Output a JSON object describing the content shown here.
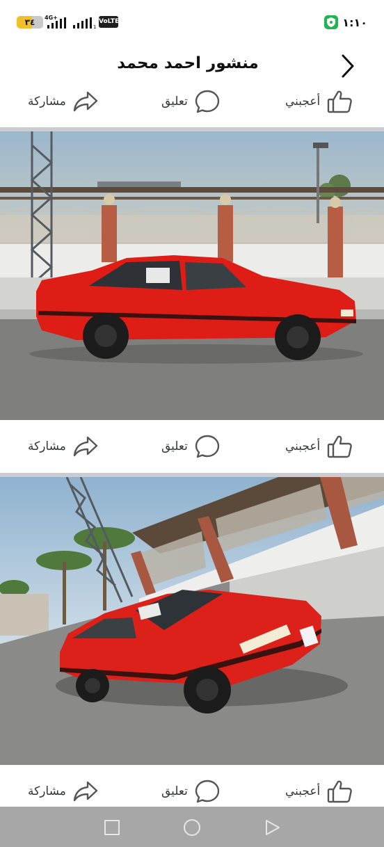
{
  "status_bar": {
    "battery": "٣٤",
    "network": "4G+",
    "volte": "VoLTE",
    "time": "١:١٠",
    "colors": {
      "battery": "#f0c02a",
      "shield": "#20b452"
    }
  },
  "header": {
    "title": "منشور احمد محمد",
    "back_icon": "chevron-right-icon"
  },
  "actions": {
    "like": "أعجبني",
    "comment": "تعليق",
    "share": "مشاركة"
  },
  "photos": [
    {
      "subject": "red-hatchback-side-view"
    },
    {
      "subject": "red-hatchback-front-three-quarter-view"
    }
  ],
  "nav": {
    "icons": [
      "recent-apps-icon",
      "home-icon",
      "back-triangle-icon"
    ]
  }
}
